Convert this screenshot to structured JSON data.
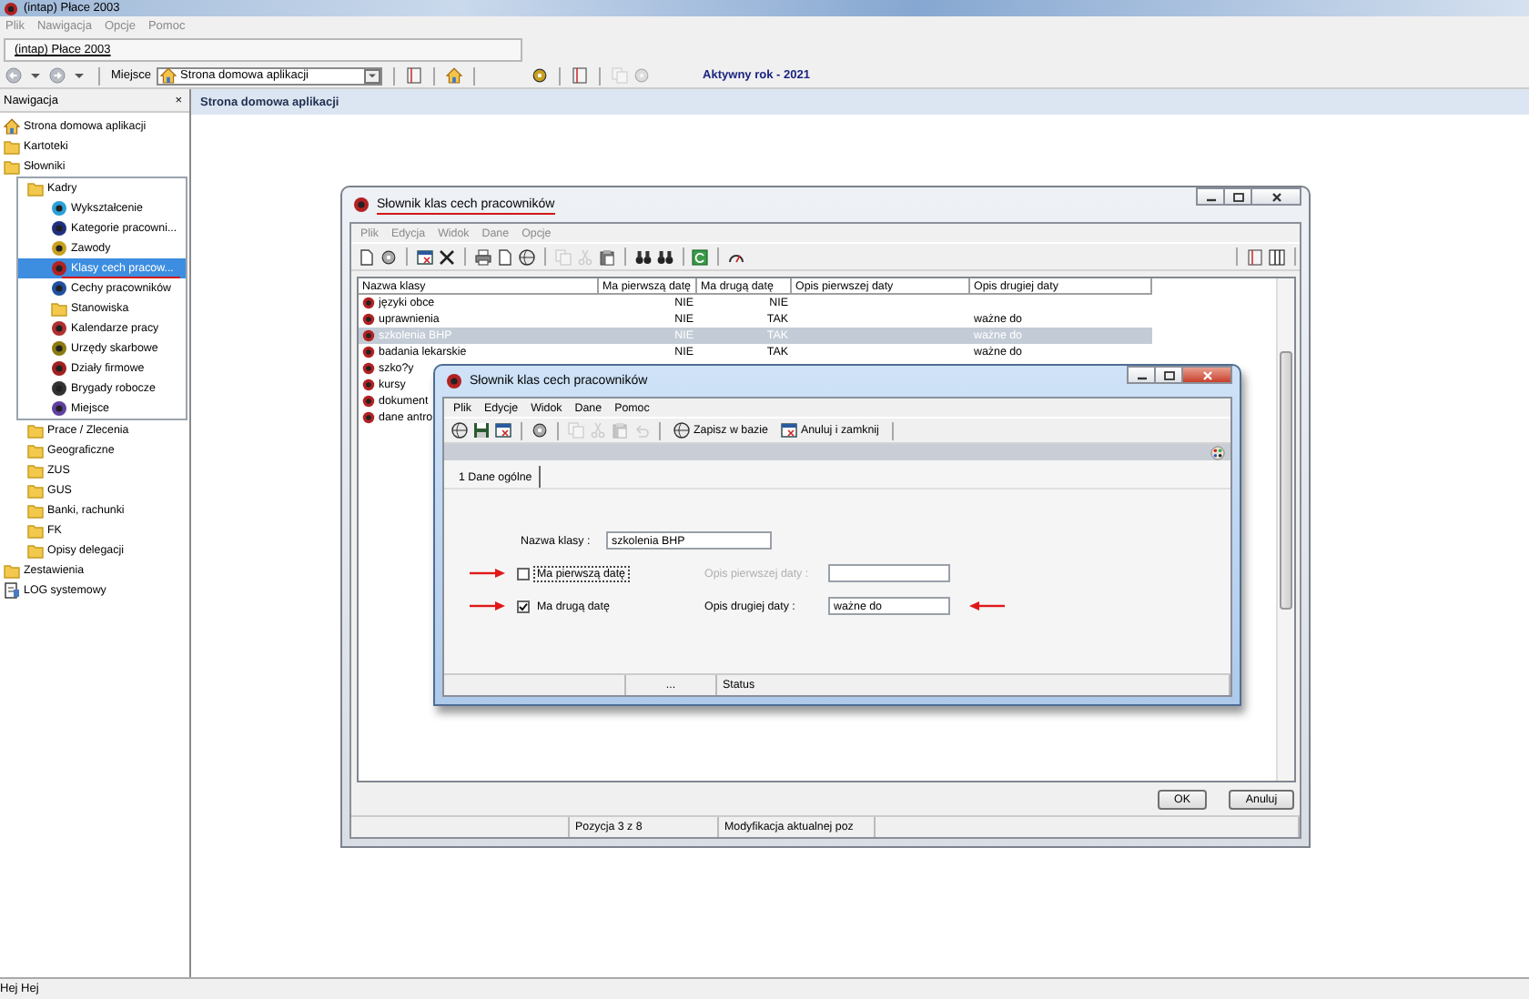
{
  "window": {
    "title": "(intap) Płace 2003"
  },
  "menu": [
    {
      "label": "Plik",
      "disabled": true
    },
    {
      "label": "Nawigacja",
      "disabled": true
    },
    {
      "label": "Opcje",
      "disabled": true
    },
    {
      "label": "Pomoc",
      "disabled": true
    }
  ],
  "tabs": [
    {
      "label": "(intap) Płace 2003",
      "selected": true
    }
  ],
  "toolbar": {
    "location_label": "Miejsce",
    "location_value": "Strona domowa aplikacji",
    "active_year": "Aktywny rok - 2021"
  },
  "sidebar": {
    "title": "Nawigacja",
    "close": "×",
    "items": [
      {
        "label": "Strona domowa aplikacji",
        "kind": "home",
        "selected": false
      },
      {
        "label": "Kartoteki",
        "kind": "folder",
        "selected": false
      },
      {
        "label": "Słowniki",
        "kind": "folder",
        "selected": false,
        "children": [
          {
            "label": "Kadry",
            "kind": "folder",
            "selected": false,
            "children": [
              {
                "label": "Wykształcenie",
                "kind": "item",
                "selected": false
              },
              {
                "label": "Kategorie pracowni...",
                "kind": "item",
                "selected": false
              },
              {
                "label": "Zawody",
                "kind": "item",
                "selected": false
              },
              {
                "label": "Klasy cech pracow...",
                "kind": "item",
                "selected": true
              },
              {
                "label": "Cechy pracowników",
                "kind": "item",
                "selected": false
              },
              {
                "label": "Stanowiska",
                "kind": "folder",
                "selected": false
              },
              {
                "label": "Kalendarze pracy",
                "kind": "item",
                "selected": false
              },
              {
                "label": "Urzędy skarbowe",
                "kind": "item",
                "selected": false
              },
              {
                "label": "Działy firmowe",
                "kind": "item",
                "selected": false
              },
              {
                "label": "Brygady robocze",
                "kind": "item",
                "selected": false
              },
              {
                "label": "Miejsce",
                "kind": "item",
                "selected": false
              }
            ]
          },
          {
            "label": "Prace / Zlecenia",
            "kind": "folder",
            "selected": false
          },
          {
            "label": "Geograficzne",
            "kind": "folder",
            "selected": false
          },
          {
            "label": "ZUS",
            "kind": "folder",
            "selected": false
          },
          {
            "label": "GUS",
            "kind": "folder",
            "selected": false
          },
          {
            "label": "Banki, rachunki",
            "kind": "folder",
            "selected": false
          },
          {
            "label": "FK",
            "kind": "folder",
            "selected": false
          },
          {
            "label": "Opisy delegacji",
            "kind": "folder",
            "selected": false
          }
        ]
      },
      {
        "label": "Zestawienia",
        "kind": "folder",
        "selected": false
      },
      {
        "label": "LOG systemowy",
        "kind": "log",
        "selected": false
      }
    ]
  },
  "content": {
    "title": "Strona domowa aplikacji"
  },
  "list_window": {
    "title": "Słownik klas cech pracowników",
    "title_underlined": true,
    "menu": [
      {
        "label": "Plik",
        "disabled": true
      },
      {
        "label": "Edycja",
        "disabled": true
      },
      {
        "label": "Widok",
        "disabled": true
      },
      {
        "label": "Dane",
        "disabled": true
      },
      {
        "label": "Opcje",
        "disabled": true
      }
    ],
    "columns": [
      "Nazwa klasy",
      "Ma pierwszą datę",
      "Ma drugą datę",
      "Opis pierwszej daty",
      "Opis drugiej daty"
    ],
    "rows": [
      {
        "name": "języki obce",
        "first_date": "NIE",
        "second_date": "NIE",
        "selected": false
      },
      {
        "name": "uprawnienia",
        "first_date": "NIE",
        "second_date": "TAK",
        "second_desc": "ważne do",
        "selected": false
      },
      {
        "name": "szkolenia BHP",
        "first_date": "NIE",
        "second_date": "TAK",
        "second_desc": "ważne do",
        "selected": true
      },
      {
        "name": "badania lekarskie",
        "first_date": "NIE",
        "second_date": "TAK",
        "second_desc": "ważne do",
        "selected": false
      },
      {
        "name": "szko?y",
        "selected": false
      },
      {
        "name": "kursy",
        "selected": false
      },
      {
        "name": "dokument",
        "selected": false
      },
      {
        "name": "dane antro",
        "selected": false
      }
    ],
    "buttons": [
      "OK",
      "Anuluj"
    ],
    "status": [
      "Pozycja 3 z 8",
      "Modyfikacja aktualnej poz"
    ]
  },
  "edit_dialog": {
    "title": "Słownik klas cech pracowników",
    "menu": [
      {
        "label": "Plik",
        "disabled": false
      },
      {
        "label": "Edycje",
        "disabled": false
      },
      {
        "label": "Widok",
        "disabled": false
      },
      {
        "label": "Dane",
        "disabled": false
      },
      {
        "label": "Pomoc",
        "disabled": false
      }
    ],
    "toolbar_buttons": [
      "Zapisz w bazie",
      "Anuluj i zamknij"
    ],
    "tabs": [
      {
        "label": "1 Dane ogólne",
        "selected": true
      }
    ],
    "class_name": {
      "label": "Nazwa klasy :",
      "value": "szkolenia BHP"
    },
    "date_fields": [
      {
        "checkbox_label": "Ma pierwszą datę",
        "checked": false,
        "focused": true,
        "description_label": "Opis pierwszej daty :",
        "arrow_left": true,
        "arrow_right": false
      },
      {
        "checkbox_label": "Ma drugą datę",
        "checked": true,
        "focused": false,
        "description_label": "Opis drugiej daty :",
        "description_value": "ważne do",
        "arrow_left": true,
        "arrow_right": true
      }
    ],
    "status": [
      "...",
      "Status"
    ]
  },
  "status_bar": "Hej Hej"
}
